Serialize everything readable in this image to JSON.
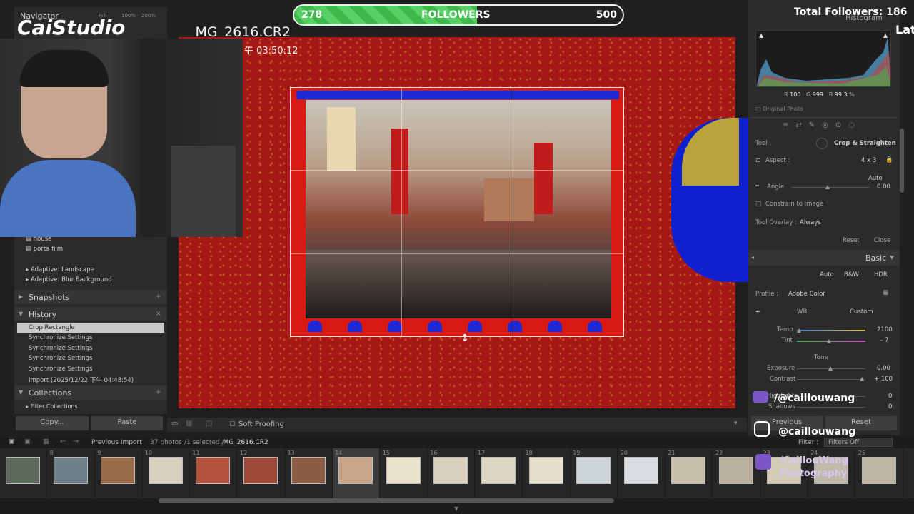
{
  "stream": {
    "brand": "CaiStudio",
    "follower_current": "278",
    "follower_label": "FOLLOWERS",
    "follower_goal": "500",
    "follower_progress": 0.556,
    "total_followers": "Total Followers: 186",
    "total_cut": "Lat",
    "youtube_handle": "/@caillouwang",
    "instagram_handle": "@caillouwang",
    "facebook_handle": "/CaillouWang",
    "facebook_sub": "Photography"
  },
  "left": {
    "navigator_label": "Navigator",
    "nav_zoom_options": [
      "FIT",
      "100%",
      "200%"
    ],
    "preset_items": [
      "house",
      "porta film"
    ],
    "adaptive_items": [
      "Adaptive: Landscape",
      "Adaptive: Blur Background"
    ],
    "snapshots_label": "Snapshots",
    "history_label": "History",
    "history_items": [
      "Crop Rectangle",
      "Synchronize Settings",
      "Synchronize Settings",
      "Synchronize Settings",
      "Synchronize Settings",
      "Import (2025/12/22 下午 04:48:54)"
    ],
    "collections_label": "Collections",
    "filter_collections": "Filter Collections",
    "copy_label": "Copy...",
    "paste_label": "Paste"
  },
  "center": {
    "filename": "_MG_2616.CR2",
    "timestamp": "午 03:50:12",
    "soft_proofing": "Soft Proofing"
  },
  "right": {
    "histogram_label": "Histogram",
    "rgb_r_label": "R",
    "rgb_r": "100",
    "rgb_g_label": "G",
    "rgb_g": "999",
    "rgb_b_label": "B",
    "rgb_b": "99.3",
    "rgb_unit": "%",
    "original_photo": "Original Photo",
    "tool_label": "Tool :",
    "tool_value": "Crop & Straighten",
    "aspect_label": "Aspect :",
    "aspect_value": "4 x 3",
    "auto_label": "Auto",
    "angle_label": "Angle",
    "angle_value": "0.00",
    "constrain_label": "Constrain to Image",
    "tool_overlay_label": "Tool Overlay :",
    "tool_overlay_value": "Always",
    "reset_label": "Reset",
    "close_label": "Close",
    "basic_label": "Basic",
    "auto_btn": "Auto",
    "bw_btn": "B&W",
    "hdr_btn": "HDR",
    "profile_label": "Profile :",
    "profile_value": "Adobe Color",
    "wb_label": "WB :",
    "wb_value": "Custom",
    "temp_label": "Temp",
    "temp_value": "2100",
    "tint_label": "Tint",
    "tint_value": "– 7",
    "tone_label": "Tone",
    "exposure_label": "Exposure",
    "exposure_value": "0.00",
    "contrast_label": "Contrast",
    "contrast_value": "+ 100",
    "highlights_label": "Highlights",
    "highlights_value": "0",
    "shadows_label": "Shadows",
    "shadows_value": "0",
    "previous_label": "Previous",
    "reset_btn": "Reset"
  },
  "filmstrip": {
    "source": "Previous Import",
    "photo_count": "37 photos",
    "selection": "/1 selected /",
    "selected_file": "_MG_2616.CR2",
    "filter_label": "Filter :",
    "filter_value": "Filters Off",
    "numbers": [
      "",
      "8",
      "9",
      "10",
      "11",
      "12",
      "13",
      "14",
      "15",
      "16",
      "17",
      "18",
      "19",
      "20",
      "21",
      "22",
      "23",
      "24",
      "25"
    ],
    "selected_index": 7
  },
  "colors": {
    "canvas_red": "#a51815",
    "sprocket_blue": "#1d2bd6",
    "progress_green": "#3db84a"
  }
}
